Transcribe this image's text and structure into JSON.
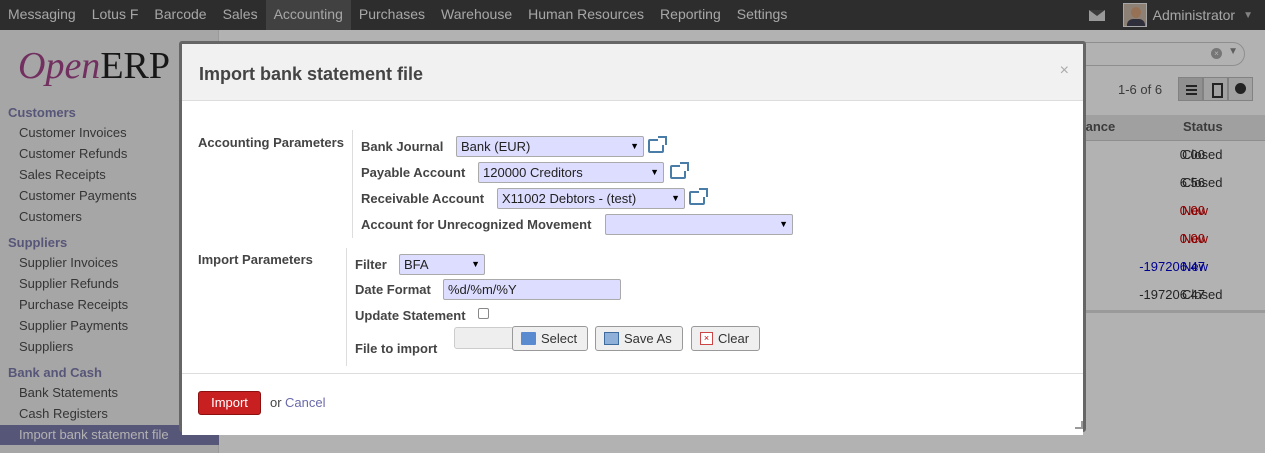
{
  "topbar": {
    "menu": [
      "Messaging",
      "Lotus F",
      "Barcode",
      "Sales",
      "Accounting",
      "Purchases",
      "Warehouse",
      "Human Resources",
      "Reporting",
      "Settings"
    ],
    "active_index": 4,
    "user_name": "Administrator",
    "mail_icon": "mail-icon",
    "caret_icon": "caret-down-icon"
  },
  "sidebar": {
    "logo_open": "Open",
    "logo_erp": "ERP",
    "sections": [
      {
        "title": "Customers",
        "items": [
          "Customer Invoices",
          "Customer Refunds",
          "Sales Receipts",
          "Customer Payments",
          "Customers"
        ]
      },
      {
        "title": "Suppliers",
        "items": [
          "Supplier Invoices",
          "Supplier Refunds",
          "Purchase Receipts",
          "Supplier Payments",
          "Suppliers"
        ]
      },
      {
        "title": "Bank and Cash",
        "items": [
          "Bank Statements",
          "Cash Registers",
          "Import bank statement file"
        ]
      }
    ],
    "selected_item": "Import bank statement file"
  },
  "main": {
    "pager": "1-6 of 6",
    "columns": {
      "balance": "lance",
      "status": "Status"
    },
    "rows": [
      {
        "balance": "0.00",
        "status": "Closed",
        "style": "normal"
      },
      {
        "balance": "6.56",
        "status": "Closed",
        "style": "normal"
      },
      {
        "balance": "0.00",
        "status": "New",
        "style": "red"
      },
      {
        "balance": "0.00",
        "status": "New",
        "style": "red"
      },
      {
        "balance": "-197206.47",
        "status": "New",
        "style": "blue"
      },
      {
        "balance": "-197206.47",
        "status": "Closed",
        "style": "normal"
      }
    ]
  },
  "dialog": {
    "title": "Import bank statement file",
    "close": "×",
    "accounting_params": {
      "label": "Accounting Parameters",
      "bank_journal": {
        "label": "Bank Journal",
        "value": "Bank (EUR)"
      },
      "payable": {
        "label": "Payable Account",
        "value": "120000 Creditors"
      },
      "receivable": {
        "label": "Receivable Account",
        "value": "X11002 Debtors - (test)"
      },
      "unrecognized": {
        "label": "Account for Unrecognized Movement",
        "value": ""
      }
    },
    "import_params": {
      "label": "Import Parameters",
      "filter": {
        "label": "Filter",
        "value": "BFA"
      },
      "date_format": {
        "label": "Date Format",
        "value": "%d/%m/%Y"
      },
      "update_statement": {
        "label": "Update Statement",
        "checked": false
      },
      "file": {
        "label": "File to import",
        "select": "Select",
        "save_as": "Save As",
        "clear": "Clear"
      }
    },
    "footer": {
      "import": "Import",
      "or": "or",
      "cancel": "Cancel"
    }
  }
}
